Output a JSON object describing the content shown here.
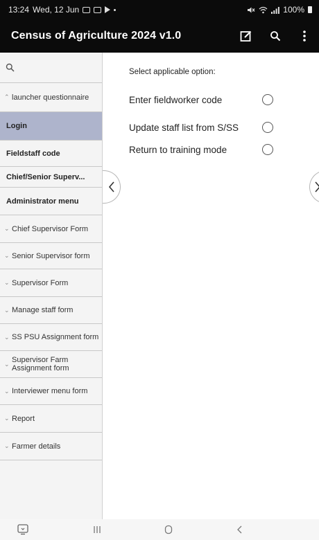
{
  "status_bar": {
    "time": "13:24",
    "date": "Wed, 12 Jun",
    "battery": "100%"
  },
  "app_bar": {
    "title": "Census of Agriculture 2024 v1.0",
    "icons": [
      "edit-icon",
      "search-icon",
      "more-vert-icon"
    ]
  },
  "sidebar": {
    "search_icon": "search-icon",
    "items": [
      {
        "label": "launcher questionnaire",
        "type": "group",
        "expanded": true
      },
      {
        "label": "Login",
        "type": "bold",
        "selected": true
      },
      {
        "label": "Fieldstaff code",
        "type": "bold"
      },
      {
        "label": "Chief/Senior Superv...",
        "type": "bold"
      },
      {
        "label": "Administrator menu",
        "type": "bold"
      },
      {
        "label": "Chief Supervisor Form",
        "type": "group"
      },
      {
        "label": "Senior Supervisor form",
        "type": "group"
      },
      {
        "label": "Supervisor Form",
        "type": "group"
      },
      {
        "label": "Manage staff form",
        "type": "group"
      },
      {
        "label": "SS PSU Assignment form",
        "type": "group"
      },
      {
        "label": "Supervisor Farm Assignment form",
        "type": "group"
      },
      {
        "label": "Interviewer menu form",
        "type": "group"
      },
      {
        "label": "Report",
        "type": "group"
      },
      {
        "label": "Farmer details",
        "type": "group"
      }
    ]
  },
  "main": {
    "prompt": "Select applicable option:",
    "options": [
      {
        "label": "Enter fieldworker code",
        "selected": false
      },
      {
        "label": "Update staff list from S/SS",
        "selected": false
      },
      {
        "label": "Return to training mode",
        "selected": false
      }
    ]
  },
  "bottom_nav": [
    "screenshot-icon",
    "recent-apps-icon",
    "home-icon",
    "back-icon"
  ]
}
